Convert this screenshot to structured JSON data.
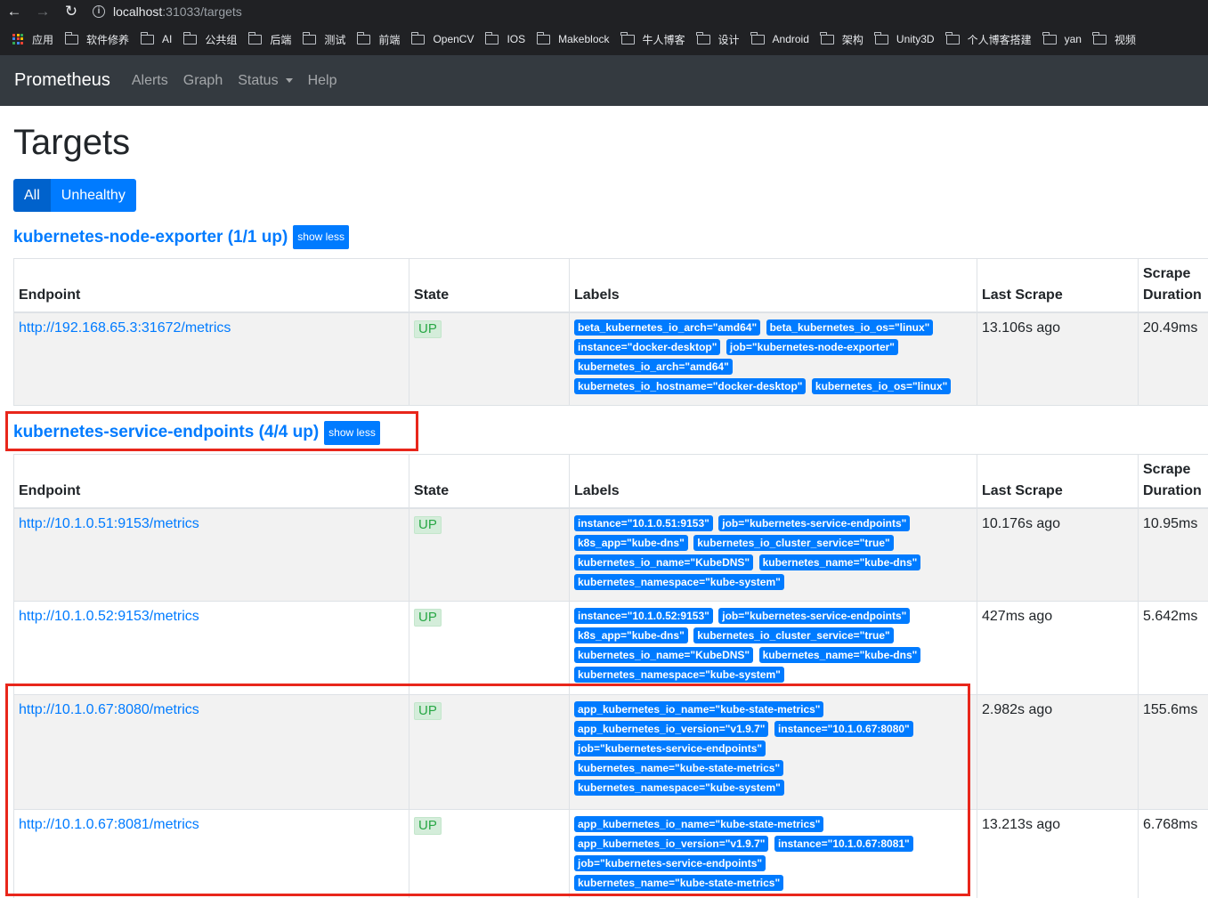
{
  "browser": {
    "url_host": "localhost",
    "url_path": ":31033/targets",
    "bookmarks": [
      "应用",
      "软件修养",
      "AI",
      "公共组",
      "后端",
      "测试",
      "前端",
      "OpenCV",
      "IOS",
      "Makeblock",
      "牛人博客",
      "设计",
      "Android",
      "架构",
      "Unity3D",
      "个人博客搭建",
      "yan",
      "视频"
    ]
  },
  "navbar": {
    "brand": "Prometheus",
    "alerts": "Alerts",
    "graph": "Graph",
    "status": "Status",
    "help": "Help"
  },
  "page_title": "Targets",
  "filters": {
    "all": "All",
    "unhealthy": "Unhealthy"
  },
  "columns": {
    "endpoint": "Endpoint",
    "state": "State",
    "labels": "Labels",
    "last_scrape": "Last Scrape",
    "scrape_duration_1": "Scrape",
    "scrape_duration_2": "Duration"
  },
  "pools": [
    {
      "title": "kubernetes-node-exporter (1/1 up)",
      "toggle": "show less",
      "targets": [
        {
          "endpoint": "http://192.168.65.3:31672/metrics",
          "state": "UP",
          "labels": [
            "beta_kubernetes_io_arch=\"amd64\"",
            "beta_kubernetes_io_os=\"linux\"",
            "instance=\"docker-desktop\"",
            "job=\"kubernetes-node-exporter\"",
            "kubernetes_io_arch=\"amd64\"",
            "kubernetes_io_hostname=\"docker-desktop\"",
            "kubernetes_io_os=\"linux\""
          ],
          "last_scrape": "13.106s ago",
          "duration": "20.49ms"
        }
      ]
    },
    {
      "title": "kubernetes-service-endpoints (4/4 up)",
      "toggle": "show less",
      "targets": [
        {
          "endpoint": "http://10.1.0.51:9153/metrics",
          "state": "UP",
          "labels": [
            "instance=\"10.1.0.51:9153\"",
            "job=\"kubernetes-service-endpoints\"",
            "k8s_app=\"kube-dns\"",
            "kubernetes_io_cluster_service=\"true\"",
            "kubernetes_io_name=\"KubeDNS\"",
            "kubernetes_name=\"kube-dns\"",
            "kubernetes_namespace=\"kube-system\""
          ],
          "last_scrape": "10.176s ago",
          "duration": "10.95ms"
        },
        {
          "endpoint": "http://10.1.0.52:9153/metrics",
          "state": "UP",
          "labels": [
            "instance=\"10.1.0.52:9153\"",
            "job=\"kubernetes-service-endpoints\"",
            "k8s_app=\"kube-dns\"",
            "kubernetes_io_cluster_service=\"true\"",
            "kubernetes_io_name=\"KubeDNS\"",
            "kubernetes_name=\"kube-dns\"",
            "kubernetes_namespace=\"kube-system\""
          ],
          "last_scrape": "427ms ago",
          "duration": "5.642ms"
        },
        {
          "endpoint": "http://10.1.0.67:8080/metrics",
          "state": "UP",
          "labels": [
            "app_kubernetes_io_name=\"kube-state-metrics\"",
            "app_kubernetes_io_version=\"v1.9.7\"",
            "instance=\"10.1.0.67:8080\"",
            "job=\"kubernetes-service-endpoints\"",
            "kubernetes_name=\"kube-state-metrics\"",
            "kubernetes_namespace=\"kube-system\""
          ],
          "last_scrape": "2.982s ago",
          "duration": "155.6ms"
        },
        {
          "endpoint": "http://10.1.0.67:8081/metrics",
          "state": "UP",
          "labels": [
            "app_kubernetes_io_name=\"kube-state-metrics\"",
            "app_kubernetes_io_version=\"v1.9.7\"",
            "instance=\"10.1.0.67:8081\"",
            "job=\"kubernetes-service-endpoints\"",
            "kubernetes_name=\"kube-state-metrics\""
          ],
          "last_scrape": "13.213s ago",
          "duration": "6.768ms"
        }
      ]
    }
  ],
  "colors": {
    "accent": "#007bff",
    "navbar": "#343a40",
    "state_up": "#28a745",
    "highlight_box": "#e8261b"
  }
}
